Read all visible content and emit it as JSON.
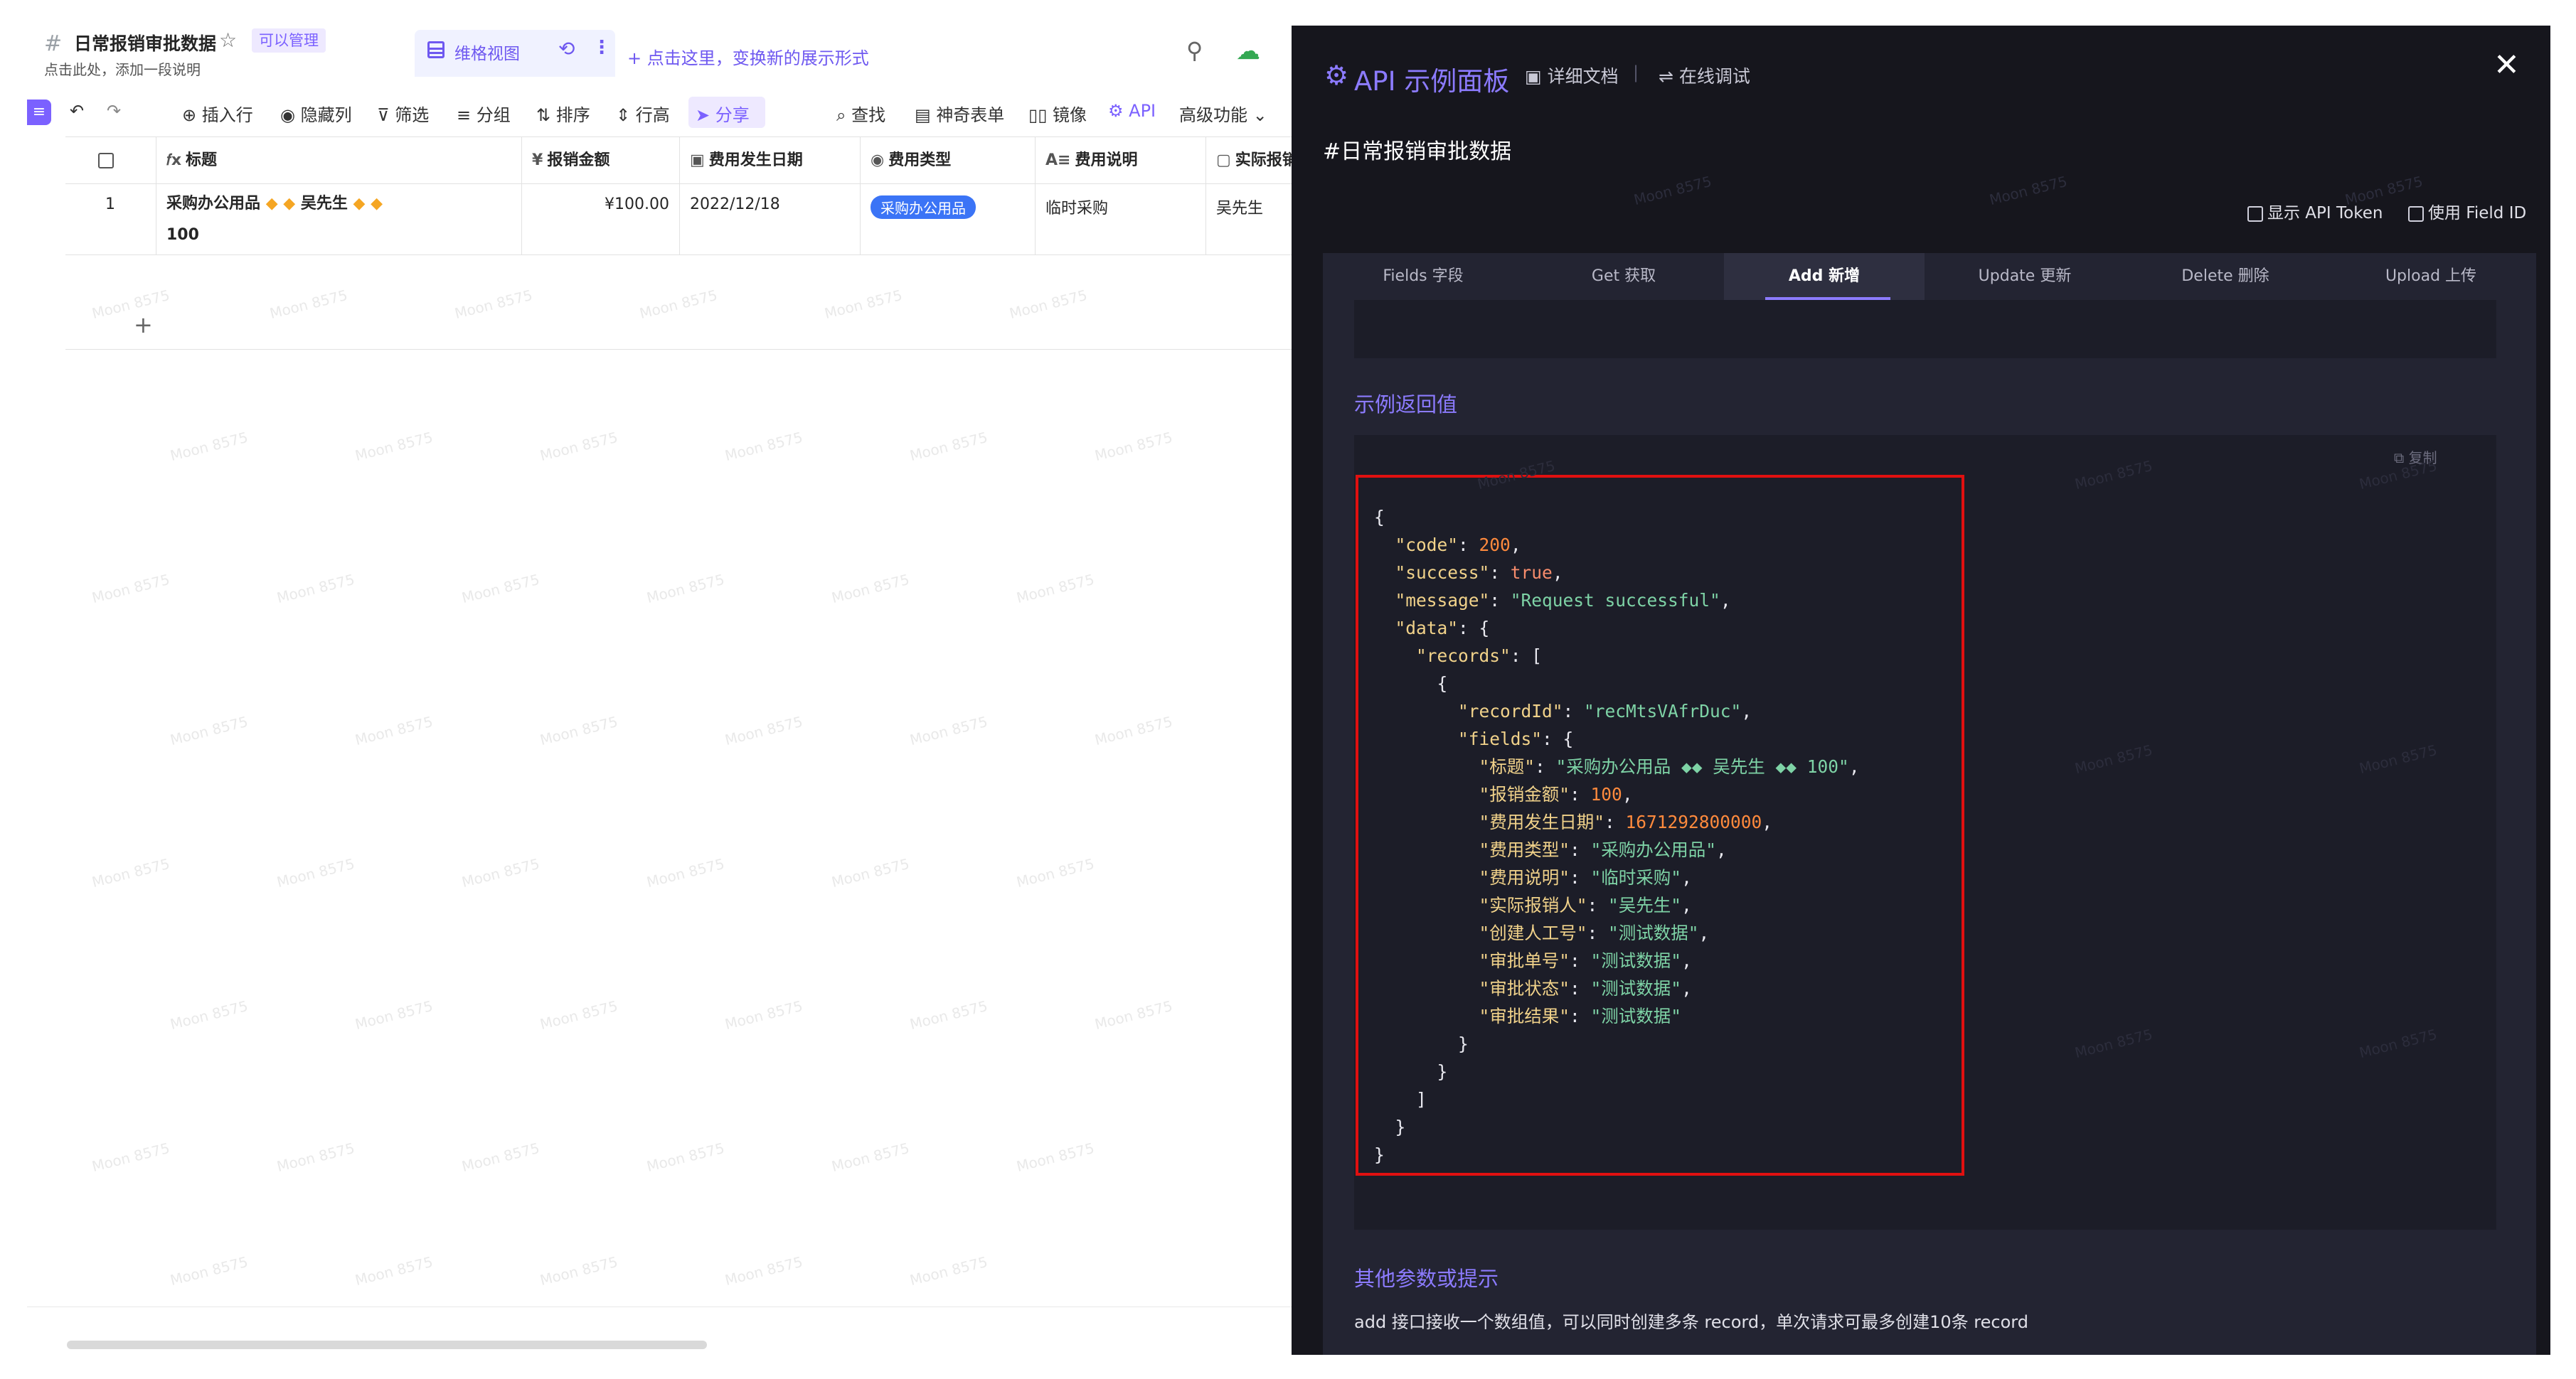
{
  "doc": {
    "title": "日常报销审批数据",
    "permission_badge": "可以管理",
    "description": "点击此处，添加一段说明",
    "view_tab_label": "维格视图",
    "add_view_hint": "+ 点击这里，变换新的展示形式"
  },
  "toolbar": {
    "undo": "↶",
    "redo": "↷",
    "insert_row": "插入行",
    "hide_columns": "隐藏列",
    "filter": "筛选",
    "group": "分组",
    "sort": "排序",
    "row_height": "行高",
    "share": "分享",
    "find": "查找",
    "magic_form": "神奇表单",
    "mirror": "镜像",
    "api": "API",
    "advanced": "高级功能"
  },
  "grid": {
    "columns": [
      "标题",
      "报销金额",
      "费用发生日期",
      "费用类型",
      "费用说明",
      "实际报销人"
    ],
    "rows": [
      {
        "index": "1",
        "title_a": "采购办公用品",
        "title_b": "吴先生",
        "title_c": "100",
        "amount": "¥100.00",
        "date": "2022/12/18",
        "type": "采购办公用品",
        "note": "临时采购",
        "person": "吴先生"
      }
    ],
    "add_row": "+"
  },
  "watermark": "Moon 8575",
  "api_panel": {
    "title": "API 示例面板",
    "nav_docs": "详细文档",
    "nav_debug": "在线调试",
    "table_name": "#日常报销审批数据",
    "show_token": "显示 API Token",
    "use_field_id": "使用 Field ID",
    "tabs": [
      "Fields 字段",
      "Get 获取",
      "Add 新增",
      "Update 更新",
      "Delete 删除",
      "Upload 上传"
    ],
    "active_tab": "Add 新增",
    "example_return_title": "示例返回值",
    "copy_label": "复制",
    "other_params_title": "其他参数或提示",
    "hint": "add 接口接收一个数组值，可以同时创建多条 record，单次请求可最多创建10条 record",
    "response": {
      "code": "200",
      "success": "true",
      "message": "\"Request successful\"",
      "recordId": "\"recMtsVAfrDuc\"",
      "fields": [
        {
          "key": "\"标题\"",
          "value": "\"采购办公用品 ◆◆ 吴先生 ◆◆ 100\"",
          "num": false
        },
        {
          "key": "\"报销金额\"",
          "value": "100",
          "num": true
        },
        {
          "key": "\"费用发生日期\"",
          "value": "1671292800000",
          "num": true
        },
        {
          "key": "\"费用类型\"",
          "value": "\"采购办公用品\"",
          "num": false
        },
        {
          "key": "\"费用说明\"",
          "value": "\"临时采购\"",
          "num": false
        },
        {
          "key": "\"实际报销人\"",
          "value": "\"吴先生\"",
          "num": false
        },
        {
          "key": "\"创建人工号\"",
          "value": "\"测试数据\"",
          "num": false
        },
        {
          "key": "\"审批单号\"",
          "value": "\"测试数据\"",
          "num": false
        },
        {
          "key": "\"审批状态\"",
          "value": "\"测试数据\"",
          "num": false
        },
        {
          "key": "\"审批结果\"",
          "value": "\"测试数据\"",
          "num": false
        }
      ]
    }
  },
  "colors": {
    "accent": "#7b61ff",
    "panel_bg": "#16161d",
    "highlight_border": "#e01010",
    "tag_blue": "#3b74f6"
  }
}
